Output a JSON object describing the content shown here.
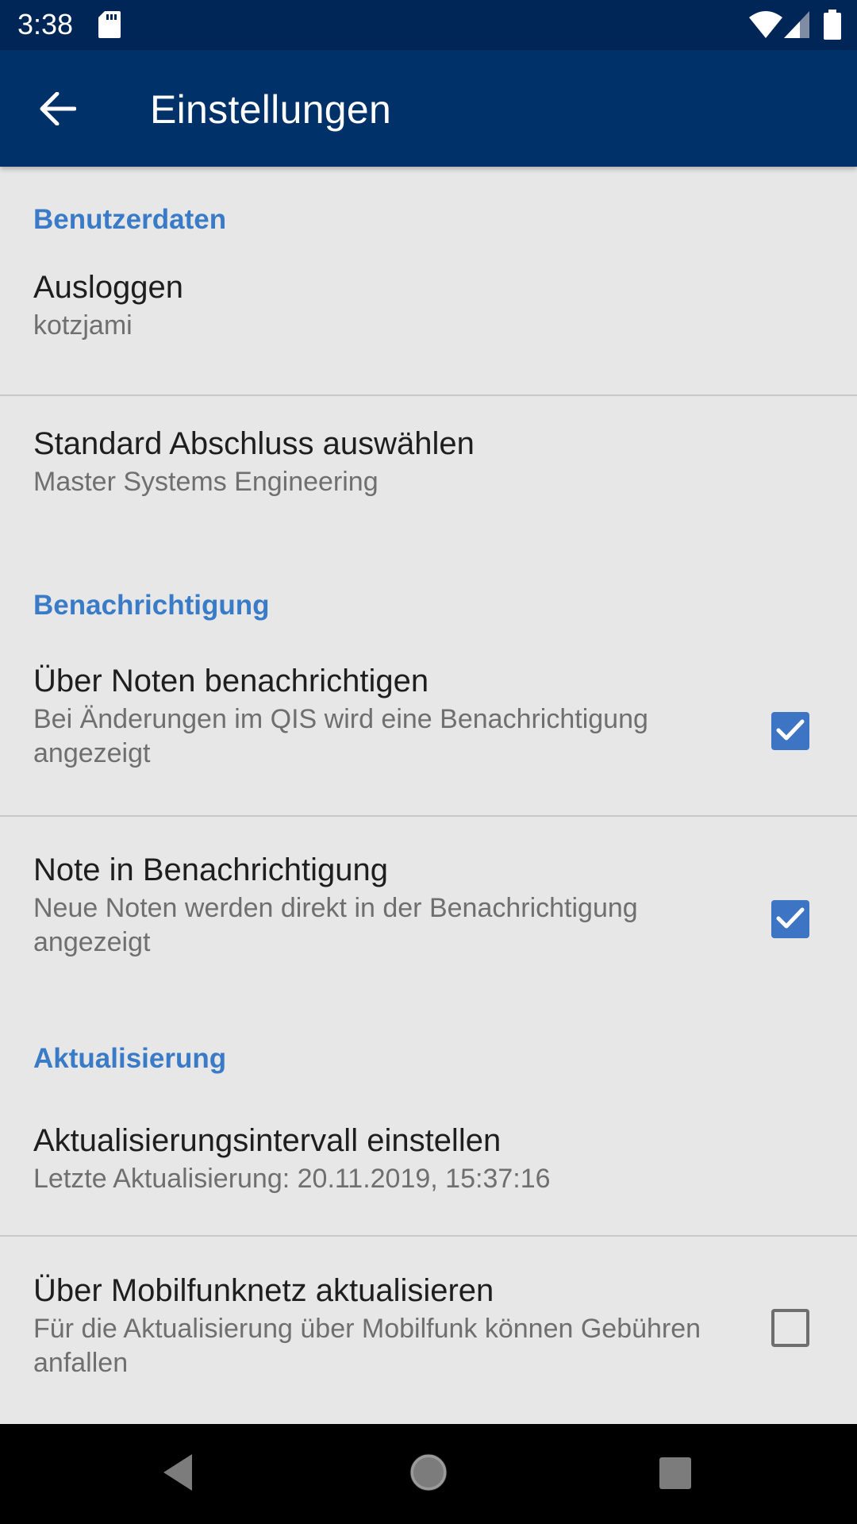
{
  "status": {
    "time": "3:38"
  },
  "appbar": {
    "title": "Einstellungen"
  },
  "sections": {
    "user": {
      "header": "Benutzerdaten"
    },
    "notify": {
      "header": "Benachrichtigung"
    },
    "update": {
      "header": "Aktualisierung"
    }
  },
  "items": {
    "logout": {
      "title": "Ausloggen",
      "summary": "kotzjami"
    },
    "degree": {
      "title": "Standard Abschluss auswählen",
      "summary": "Master Systems Engineering"
    },
    "notify_grades": {
      "title": "Über Noten benachrichtigen",
      "summary": "Bei Änderungen im QIS wird eine Benachrichtigung angezeigt",
      "checked": true
    },
    "grade_in_notification": {
      "title": "Note in Benachrichtigung",
      "summary": "Neue Noten werden direkt in der Benachrichtigung angezeigt",
      "checked": true
    },
    "interval": {
      "title": "Aktualisierungsintervall einstellen",
      "summary": "Letzte Aktualisierung: 20.11.2019, 15:37:16"
    },
    "mobile": {
      "title": "Über Mobilfunknetz aktualisieren",
      "summary": "Für die Aktualisierung über Mobilfunk können Gebühren anfallen",
      "checked": false
    }
  },
  "colors": {
    "statusbar": "#002657",
    "appbar": "#003168",
    "accent": "#3d74c4",
    "section_header": "#3a7bc8",
    "background": "#e7e7e8"
  }
}
